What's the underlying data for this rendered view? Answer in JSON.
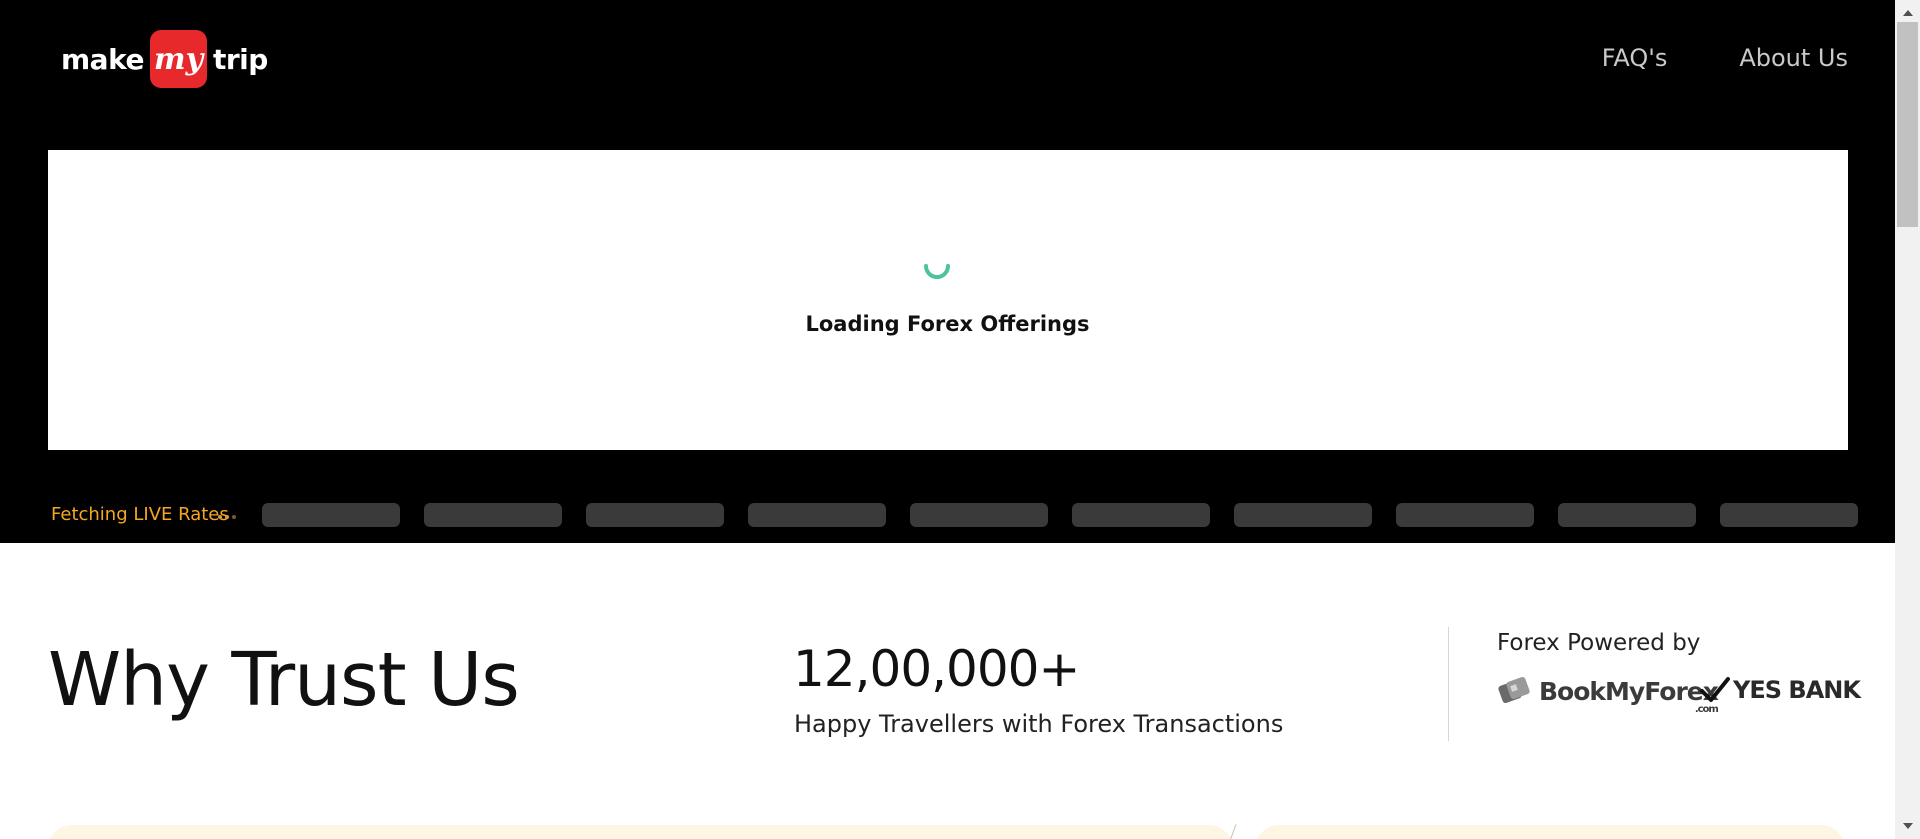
{
  "header": {
    "logo": {
      "make": "make",
      "my": "my",
      "trip": "trip"
    },
    "nav": [
      {
        "label": "FAQ's"
      },
      {
        "label": "About Us"
      }
    ]
  },
  "loader": {
    "text": "Loading Forex Offerings",
    "spinner_color": "#4cc39a"
  },
  "rates": {
    "label": "Fetching LIVE Rates",
    "label_color": "#f5a623",
    "skeleton_count": 10
  },
  "trust": {
    "heading": "Why Trust Us",
    "stat_number": "12,00,000+",
    "stat_text": "Happy Travellers with Forex Transactions",
    "powered_label": "Forex Powered by",
    "partners": {
      "bookmyforex": "BookMyForex",
      "bookmyforex_suffix": ".com",
      "yesbank": "YES BANK"
    }
  }
}
